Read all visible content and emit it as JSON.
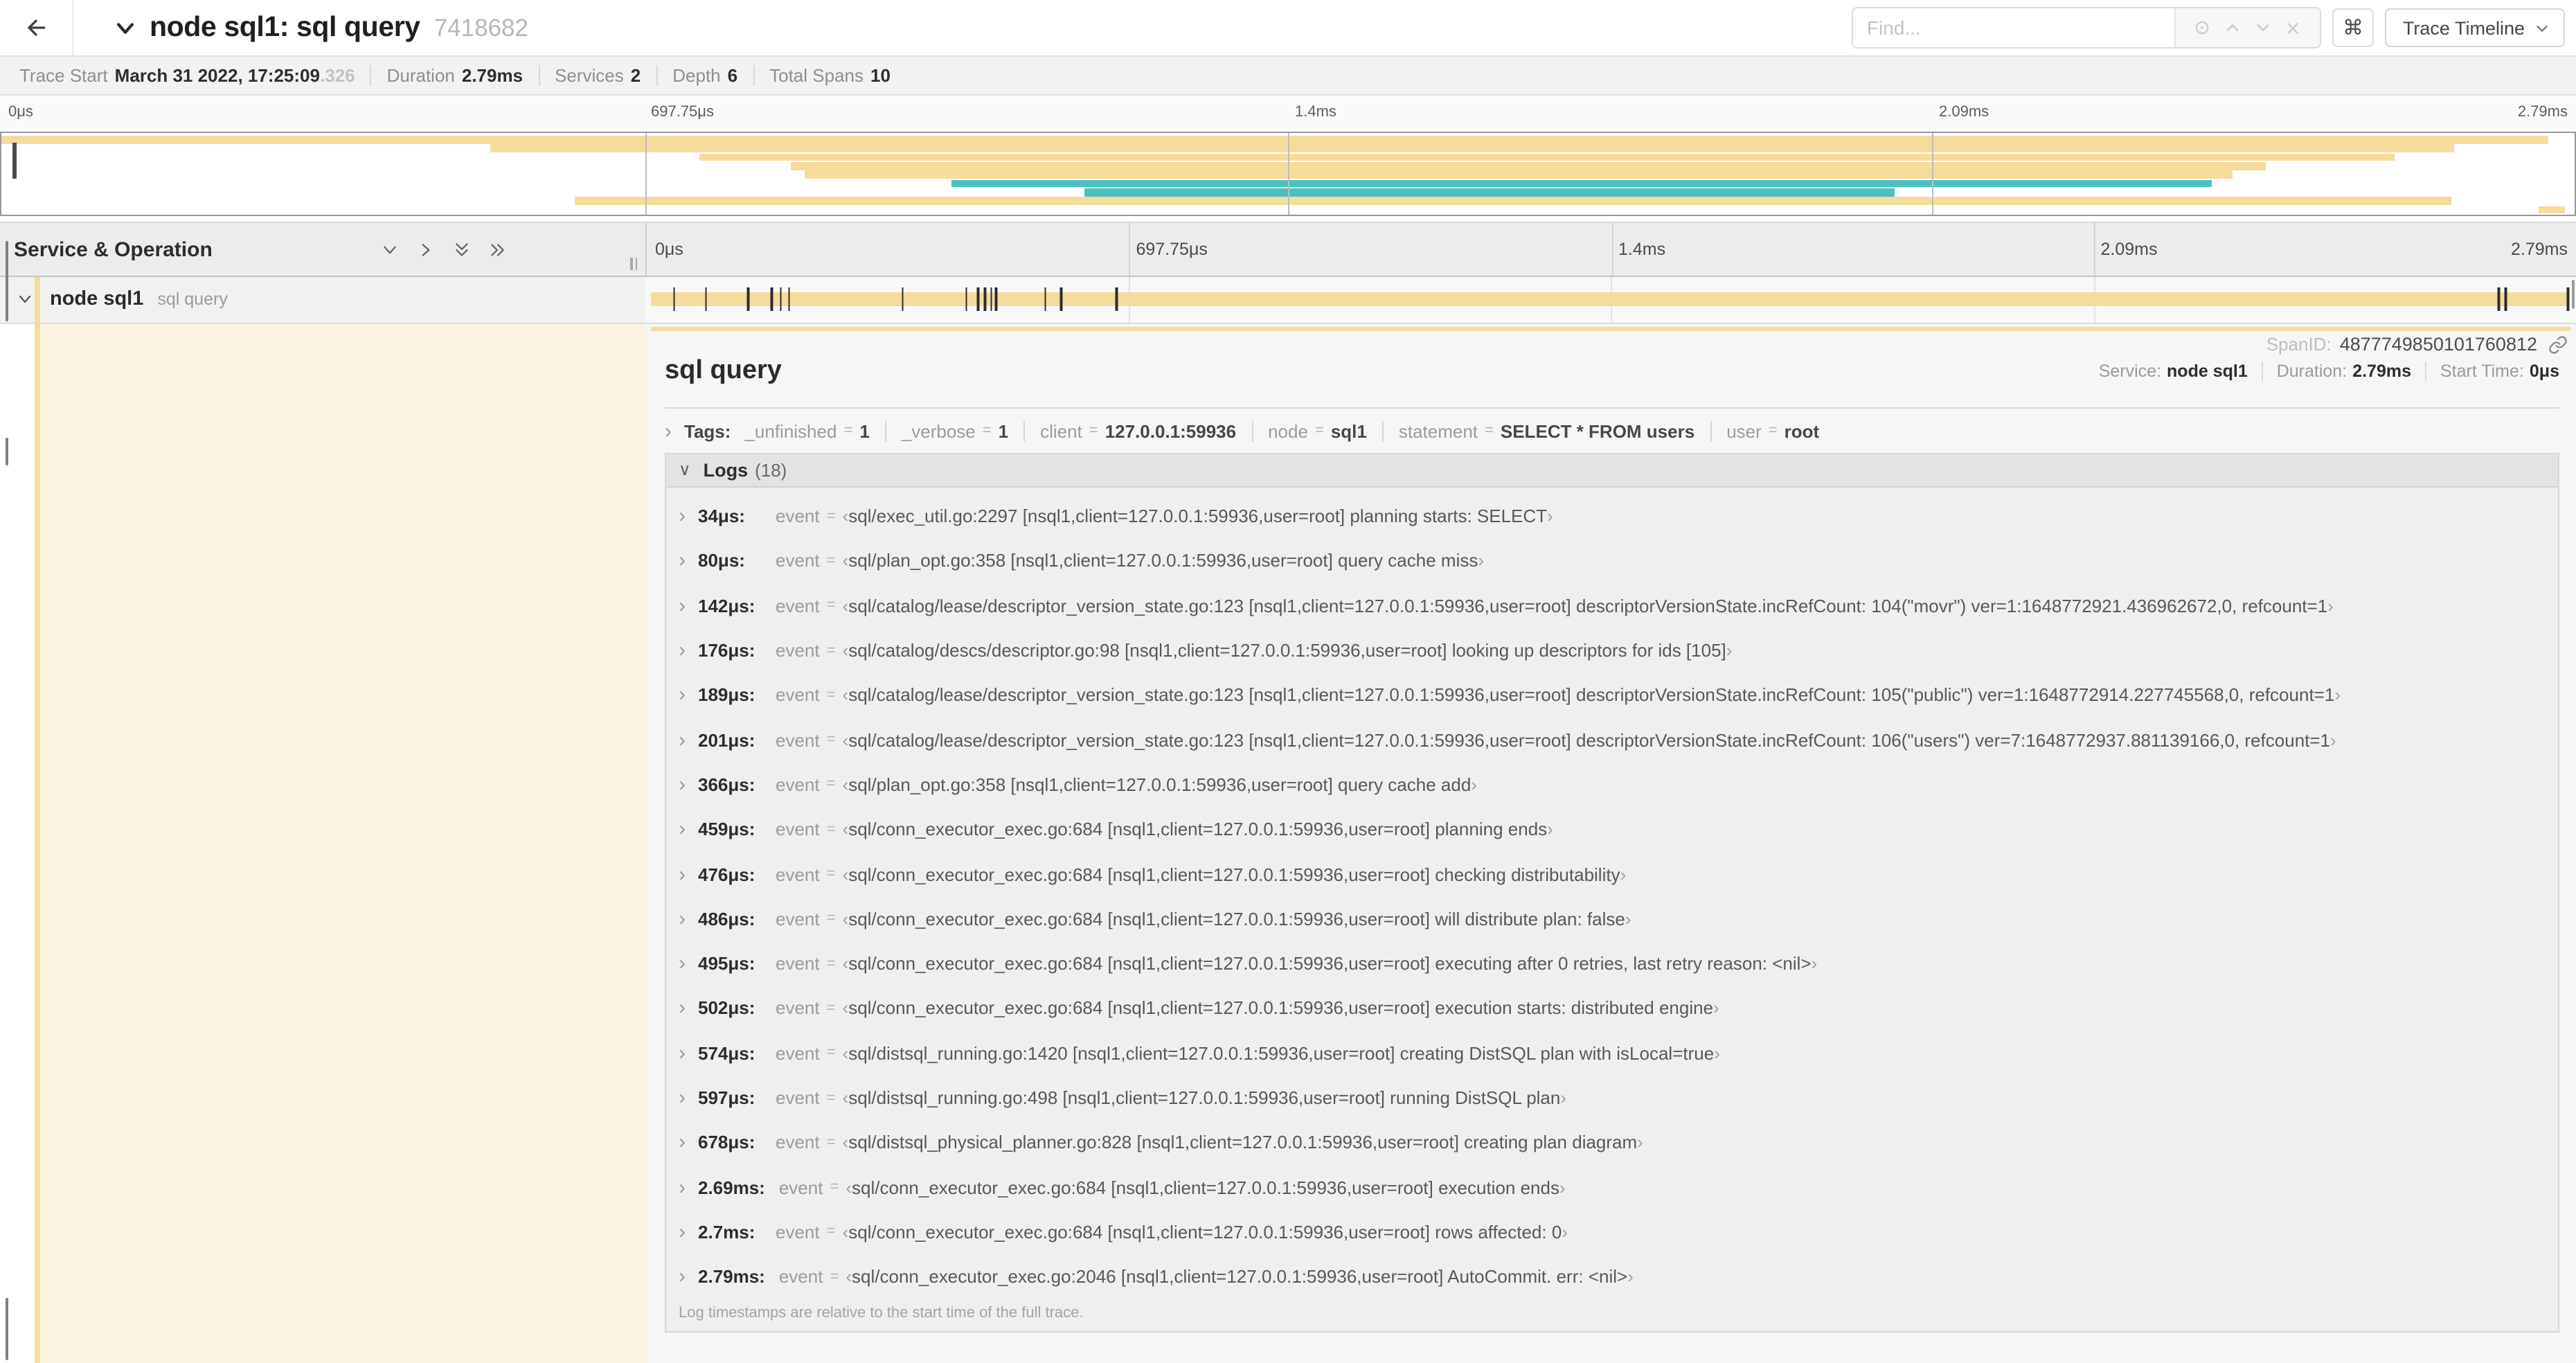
{
  "colors": {
    "tan": "#F5DB9C",
    "teal": "#49C1C1",
    "cream": "#FCF3E2"
  },
  "header": {
    "title": "node sql1: sql query",
    "trace_id": "7418682",
    "find_placeholder": "Find...",
    "shortcut_glyph": "⌘",
    "view_select_label": "Trace Timeline"
  },
  "trace_stats": {
    "trace_start_label": "Trace Start",
    "trace_start_value": "March 31 2022, 17:25:09",
    "trace_start_fraction": ".326",
    "duration_label": "Duration",
    "duration_value": "2.79ms",
    "services_label": "Services",
    "services_value": "2",
    "depth_label": "Depth",
    "depth_value": "6",
    "total_spans_label": "Total Spans",
    "total_spans_value": "10"
  },
  "timeline": {
    "left_header": "Service & Operation",
    "ticks": [
      {
        "label": "0μs",
        "pos": 0
      },
      {
        "label": "697.75μs",
        "pos": 25
      },
      {
        "label": "1.4ms",
        "pos": 50
      },
      {
        "label": "2.09ms",
        "pos": 75
      },
      {
        "label": "2.79ms",
        "pos": 100
      }
    ]
  },
  "minimap": {
    "spans": [
      {
        "start": 0.0,
        "end": 99.0,
        "color": "tan"
      },
      {
        "start": 19.0,
        "end": 95.3,
        "color": "tan"
      },
      {
        "start": 27.1,
        "end": 93.0,
        "color": "tan"
      },
      {
        "start": 30.7,
        "end": 88.0,
        "color": "tan"
      },
      {
        "start": 31.2,
        "end": 86.7,
        "color": "tan"
      },
      {
        "start": 36.9,
        "end": 85.9,
        "color": "teal"
      },
      {
        "start": 42.1,
        "end": 73.6,
        "color": "teal"
      },
      {
        "start": 22.3,
        "end": 95.2,
        "color": "tan"
      },
      {
        "start": 98.6,
        "end": 99.6,
        "color": "tan"
      }
    ]
  },
  "span_row": {
    "service": "node sql1",
    "operation": "sql query",
    "total_us": 2790,
    "event_times_us": [
      34,
      80,
      142,
      176,
      189,
      201,
      366,
      459,
      476,
      486,
      495,
      502,
      574,
      597,
      678,
      2690,
      2700,
      2790
    ]
  },
  "detail": {
    "title": "sql query",
    "service_label": "Service:",
    "service": "node sql1",
    "duration_label": "Duration:",
    "duration": "2.79ms",
    "start_time_label": "Start Time:",
    "start_time": "0μs",
    "tags_label": "Tags:",
    "tags": [
      {
        "key": "_unfinished",
        "value": "1"
      },
      {
        "key": "_verbose",
        "value": "1"
      },
      {
        "key": "client",
        "value": "127.0.0.1:59936"
      },
      {
        "key": "node",
        "value": "sql1"
      },
      {
        "key": "statement",
        "value": "SELECT * FROM users"
      },
      {
        "key": "user",
        "value": "root"
      }
    ],
    "logs_label": "Logs",
    "logs_count": "(18)",
    "log_field_key": "event",
    "open_quote": "‹",
    "close_quote": "›",
    "logs": [
      {
        "time": "34μs:",
        "value": "sql/exec_util.go:2297 [nsql1,client=127.0.0.1:59936,user=root] planning starts: SELECT"
      },
      {
        "time": "80μs:",
        "value": "sql/plan_opt.go:358 [nsql1,client=127.0.0.1:59936,user=root] query cache miss"
      },
      {
        "time": "142μs:",
        "value": "sql/catalog/lease/descriptor_version_state.go:123 [nsql1,client=127.0.0.1:59936,user=root] descriptorVersionState.incRefCount: 104(\"movr\") ver=1:1648772921.436962672,0, refcount=1"
      },
      {
        "time": "176μs:",
        "value": "sql/catalog/descs/descriptor.go:98 [nsql1,client=127.0.0.1:59936,user=root] looking up descriptors for ids [105]"
      },
      {
        "time": "189μs:",
        "value": "sql/catalog/lease/descriptor_version_state.go:123 [nsql1,client=127.0.0.1:59936,user=root] descriptorVersionState.incRefCount: 105(\"public\") ver=1:1648772914.227745568,0, refcount=1"
      },
      {
        "time": "201μs:",
        "value": "sql/catalog/lease/descriptor_version_state.go:123 [nsql1,client=127.0.0.1:59936,user=root] descriptorVersionState.incRefCount: 106(\"users\") ver=7:1648772937.881139166,0, refcount=1"
      },
      {
        "time": "366μs:",
        "value": "sql/plan_opt.go:358 [nsql1,client=127.0.0.1:59936,user=root] query cache add"
      },
      {
        "time": "459μs:",
        "value": "sql/conn_executor_exec.go:684 [nsql1,client=127.0.0.1:59936,user=root] planning ends"
      },
      {
        "time": "476μs:",
        "value": "sql/conn_executor_exec.go:684 [nsql1,client=127.0.0.1:59936,user=root] checking distributability"
      },
      {
        "time": "486μs:",
        "value": "sql/conn_executor_exec.go:684 [nsql1,client=127.0.0.1:59936,user=root] will distribute plan: false"
      },
      {
        "time": "495μs:",
        "value": "sql/conn_executor_exec.go:684 [nsql1,client=127.0.0.1:59936,user=root] executing after 0 retries, last retry reason: <nil>"
      },
      {
        "time": "502μs:",
        "value": "sql/conn_executor_exec.go:684 [nsql1,client=127.0.0.1:59936,user=root] execution starts: distributed engine"
      },
      {
        "time": "574μs:",
        "value": "sql/distsql_running.go:1420 [nsql1,client=127.0.0.1:59936,user=root] creating DistSQL plan with isLocal=true"
      },
      {
        "time": "597μs:",
        "value": "sql/distsql_running.go:498 [nsql1,client=127.0.0.1:59936,user=root] running DistSQL plan"
      },
      {
        "time": "678μs:",
        "value": "sql/distsql_physical_planner.go:828 [nsql1,client=127.0.0.1:59936,user=root] creating plan diagram"
      },
      {
        "time": "2.69ms:",
        "value": "sql/conn_executor_exec.go:684 [nsql1,client=127.0.0.1:59936,user=root] execution ends"
      },
      {
        "time": "2.7ms:",
        "value": "sql/conn_executor_exec.go:684 [nsql1,client=127.0.0.1:59936,user=root] rows affected: 0"
      },
      {
        "time": "2.79ms:",
        "value": "sql/conn_executor_exec.go:2046 [nsql1,client=127.0.0.1:59936,user=root] AutoCommit. err: <nil>"
      }
    ],
    "footer": "Log timestamps are relative to the start time of the full trace.",
    "span_id_label": "SpanID:",
    "span_id": "4877749850101760812"
  }
}
